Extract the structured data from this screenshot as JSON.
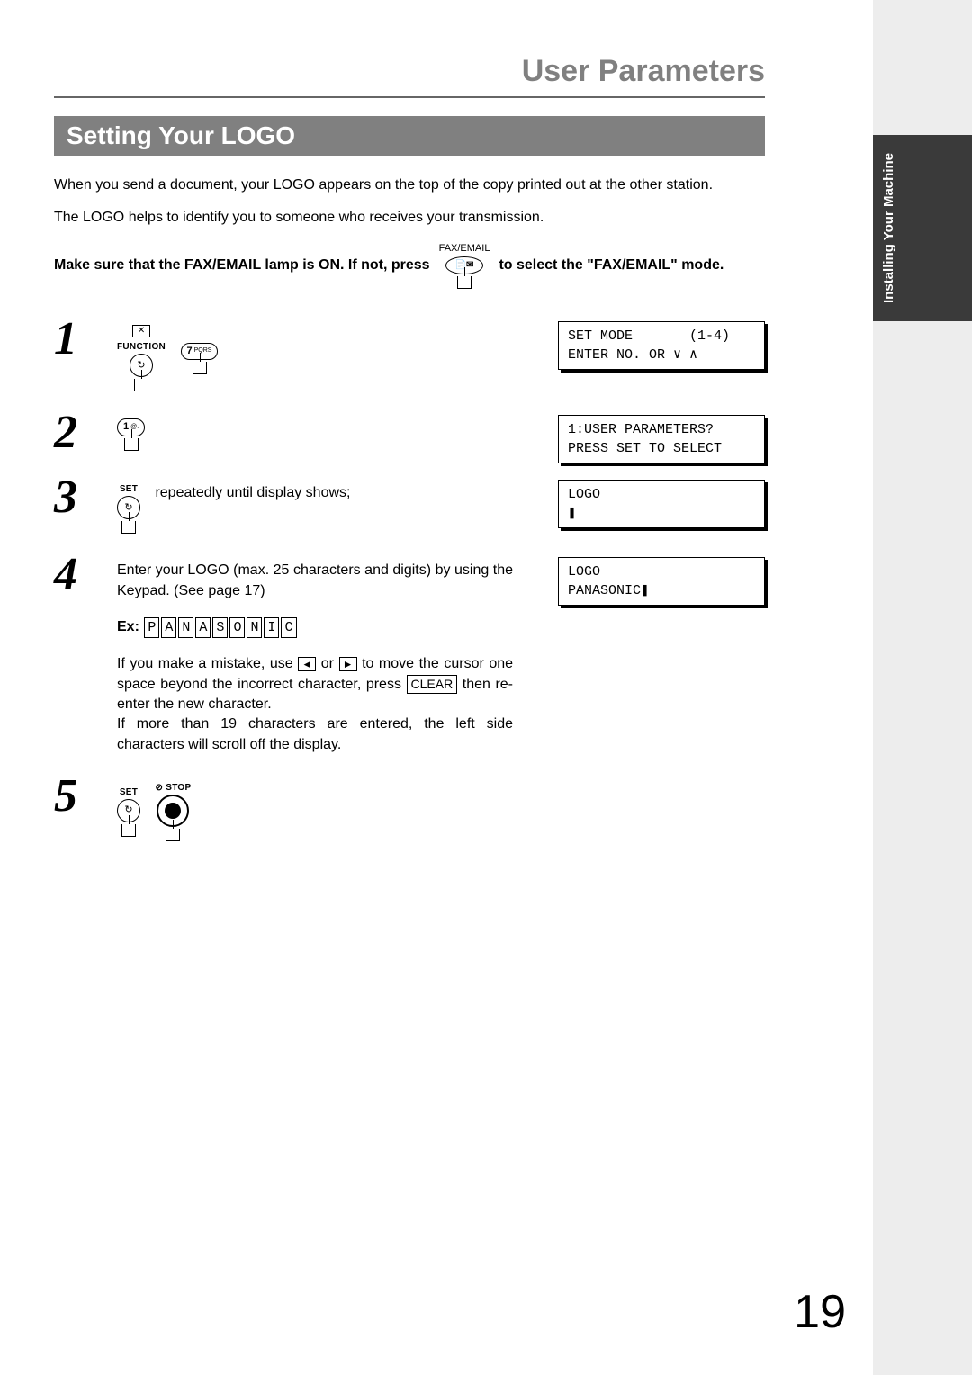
{
  "header": {
    "title": "User Parameters"
  },
  "section_title": "Setting Your LOGO",
  "intro": {
    "p1": "When you send a document, your LOGO appears on the top of the copy printed out at the other station.",
    "p2": "The LOGO helps to identify you to someone who receives your transmission."
  },
  "mode_line": {
    "prefix": "Make sure that the FAX/EMAIL lamp is ON.  If not, press",
    "icon_label": "FAX/EMAIL",
    "suffix": "to select the \"FAX/EMAIL\" mode."
  },
  "steps": [
    {
      "n": "1",
      "icons": [
        {
          "label": "FUNCTION",
          "type": "function"
        },
        {
          "label": "",
          "type": "key",
          "text": "7",
          "sub": "PQRS"
        }
      ],
      "lcd": "SET MODE       (1-4)\nENTER NO. OR ∨ ∧"
    },
    {
      "n": "2",
      "icons": [
        {
          "label": "",
          "type": "key",
          "text": "1",
          "sub": "@."
        }
      ],
      "lcd": "1:USER PARAMETERS?\nPRESS SET TO SELECT"
    },
    {
      "n": "3",
      "icons": [
        {
          "label": "SET",
          "type": "set"
        }
      ],
      "text_after": " repeatedly until display shows;",
      "lcd": "LOGO\n❚"
    },
    {
      "n": "4",
      "body": "Enter your LOGO (max. 25 characters and digits) by using the Keypad. (See page 17)",
      "example_label": "Ex:",
      "example_chars": [
        "P",
        "A",
        "N",
        "A",
        "S",
        "O",
        "N",
        "I",
        "C"
      ],
      "mistake_p1_a": "If you make a mistake, use ",
      "mistake_p1_b": " or ",
      "mistake_p1_c": " to move the cursor one space beyond the incorrect character, press ",
      "clear_label": "CLEAR",
      "mistake_p1_d": " then re-enter the new character.",
      "mistake_p2": "If more than 19 characters are entered, the left side characters will scroll off the display.",
      "lcd": "LOGO\nPANASONIC❚"
    },
    {
      "n": "5",
      "icons": [
        {
          "label": "SET",
          "type": "set"
        },
        {
          "label": "STOP",
          "type": "stop"
        }
      ]
    }
  ],
  "sidebar_tab": "Installing Your\nMachine",
  "page_number": "19"
}
